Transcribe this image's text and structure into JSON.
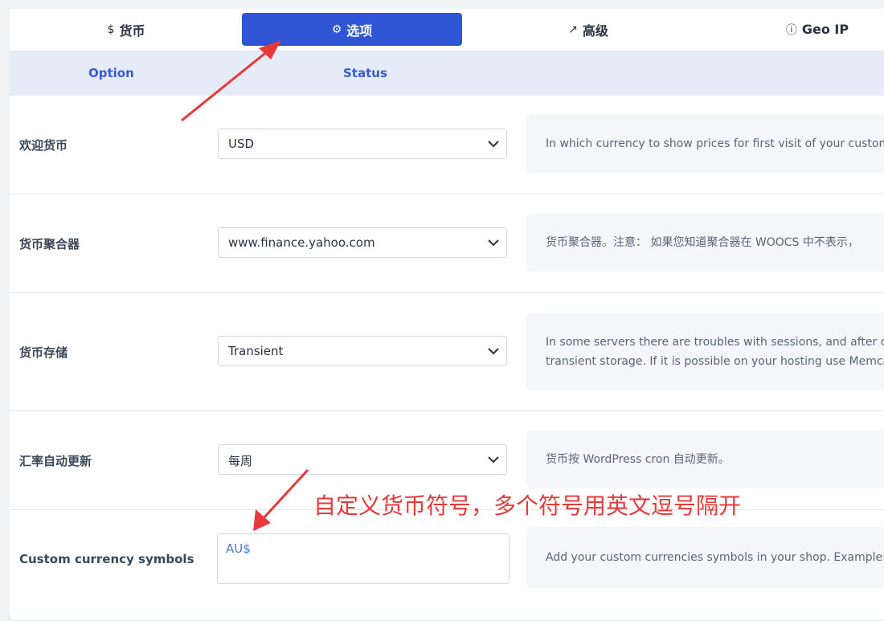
{
  "tabs": [
    {
      "label": "货币",
      "icon": "dollar-icon",
      "glyph": "$"
    },
    {
      "label": "选项",
      "icon": "gear-icon",
      "glyph": "⚙"
    },
    {
      "label": "高级",
      "icon": "external-link-icon",
      "glyph": "↗"
    },
    {
      "label": "Geo IP",
      "icon": "info-circle-icon",
      "glyph": "ⓘ"
    }
  ],
  "active_tab": "选项",
  "table": {
    "headers": {
      "option": "Option",
      "status": "Status"
    },
    "rows": [
      {
        "label": "欢迎货币",
        "value": "USD",
        "description": [
          "In which currency to show prices for first visit of your customer on"
        ]
      },
      {
        "label": "货币聚合器",
        "value": "www.finance.yahoo.com",
        "description": [
          "货币聚合器。注意： 如果您知道聚合器在 WOOCS 中不表示，"
        ]
      },
      {
        "label": "货币存储",
        "value": "Transient",
        "description": [
          "In some servers there are troubles with sessions, and after currency",
          "transient storage. If it is possible on your hosting use Memcached"
        ]
      },
      {
        "label": "汇率自动更新",
        "value": "每周",
        "description": [
          "货币按 WordPress cron 自动更新。"
        ]
      },
      {
        "label": "Custom currency symbols",
        "value": "AU$",
        "description": [
          "Add your custom currencies symbols in your shop. Example: $USD,"
        ]
      }
    ]
  },
  "annotation": {
    "text": "自定义货币符号，多个符号用英文逗号隔开",
    "color": "#e8393a"
  },
  "colors": {
    "accent": "#2f55d4",
    "header_bg": "#e6ebf8",
    "header_text": "#3a5ad6"
  }
}
